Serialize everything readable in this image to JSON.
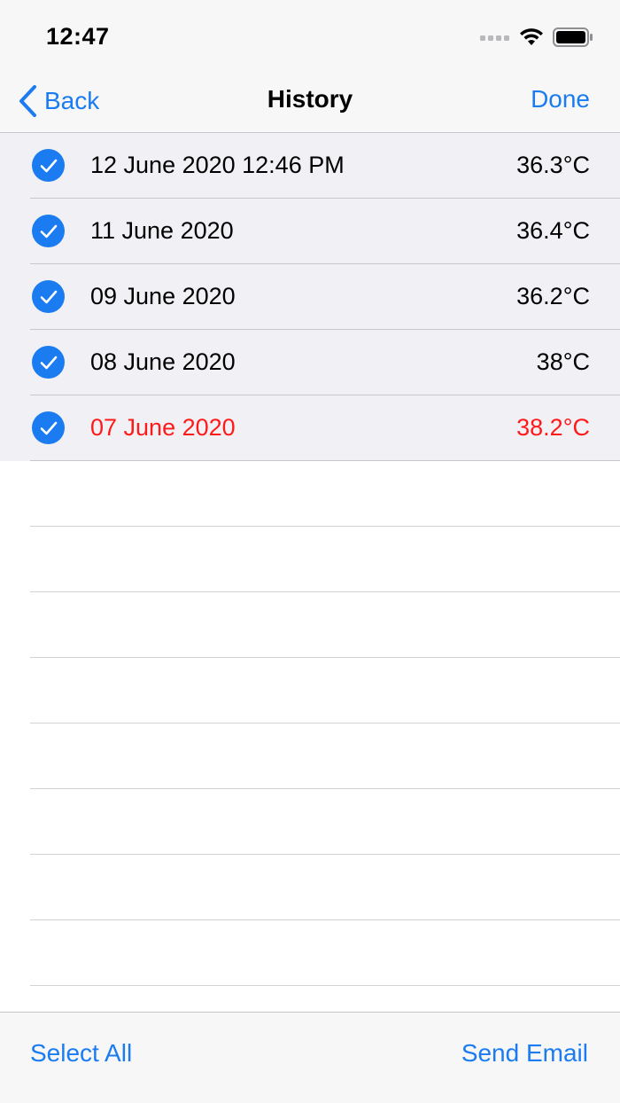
{
  "status_bar": {
    "time": "12:47",
    "icons": [
      "signal-icon",
      "wifi-icon",
      "battery-icon"
    ]
  },
  "nav": {
    "back_label": "Back",
    "title": "History",
    "done_label": "Done"
  },
  "history": [
    {
      "date": "12 June 2020 12:46 PM",
      "temp": "36.3°C",
      "selected": true,
      "alert": false
    },
    {
      "date": "11 June 2020",
      "temp": "36.4°C",
      "selected": true,
      "alert": false
    },
    {
      "date": "09 June 2020",
      "temp": "36.2°C",
      "selected": true,
      "alert": false
    },
    {
      "date": "08 June 2020",
      "temp": "38°C",
      "selected": true,
      "alert": false
    },
    {
      "date": "07 June 2020",
      "temp": "38.2°C",
      "selected": true,
      "alert": true
    }
  ],
  "toolbar": {
    "select_all_label": "Select All",
    "send_email_label": "Send Email"
  },
  "colors": {
    "accent": "#1a7cf0",
    "alert": "#ff1a1a",
    "selected_row_bg": "#f1f1f5"
  }
}
